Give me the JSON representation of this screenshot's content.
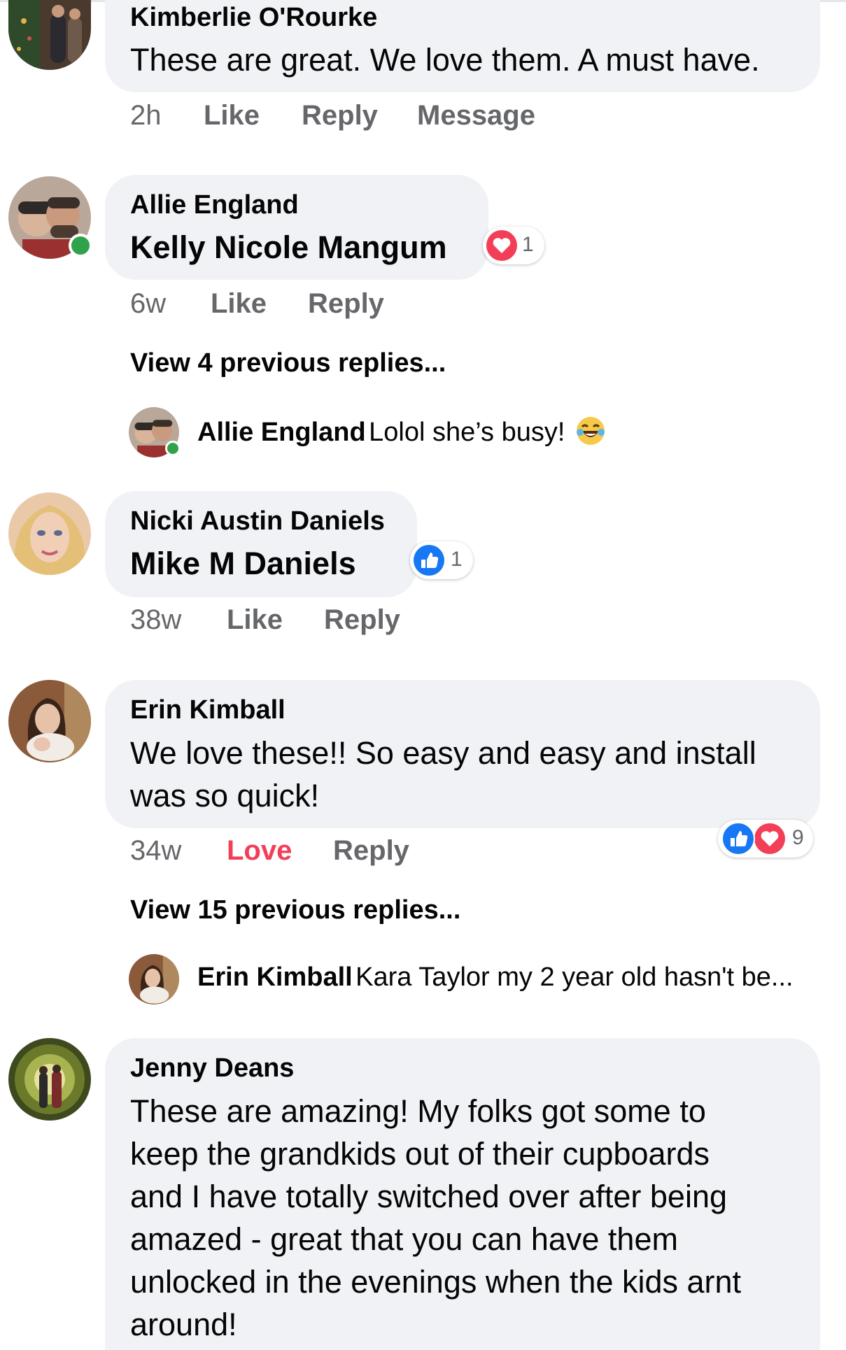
{
  "comments": [
    {
      "author": "Kimberlie O'Rourke",
      "text": "These are great. We love them. A must have.",
      "meta": {
        "time": "2h",
        "like": "Like",
        "reply": "Reply",
        "message": "Message"
      }
    },
    {
      "author": "Allie England",
      "tag": "Kelly Nicole Mangum",
      "reaction": {
        "icons": [
          "heart-icon"
        ],
        "count": "1"
      },
      "meta": {
        "time": "6w",
        "like": "Like",
        "reply": "Reply"
      },
      "view_replies": "View 4 previous replies...",
      "latest_reply": {
        "author": "Allie England",
        "text": "Lolol she’s busy!",
        "emoji": "laughing-tears-emoji"
      }
    },
    {
      "author": "Nicki Austin Daniels",
      "tag": "Mike M Daniels",
      "reaction": {
        "icons": [
          "like-icon"
        ],
        "count": "1"
      },
      "meta": {
        "time": "38w",
        "like": "Like",
        "reply": "Reply"
      }
    },
    {
      "author": "Erin Kimball",
      "text_lines": [
        "We love these!! So easy and easy and install",
        "was so quick!"
      ],
      "reaction": {
        "icons": [
          "like-icon",
          "heart-icon"
        ],
        "count": "9"
      },
      "meta": {
        "time": "34w",
        "like": "Love",
        "reply": "Reply"
      },
      "view_replies": "View 15 previous replies...",
      "latest_reply": {
        "author": "Erin Kimball",
        "text": "Kara Taylor my 2 year old hasn't be..."
      }
    },
    {
      "author": "Jenny Deans",
      "text_lines": [
        "These are amazing! My folks got some to",
        "keep the grandkids out of their cupboards",
        "and I have totally switched over after being",
        "amazed - great that you can have them",
        "unlocked in the evenings when the kids arnt",
        "around!"
      ]
    }
  ],
  "colors": {
    "like_blue": "#1877f2",
    "love_red": "#f33e58",
    "meta_gray": "#65676b",
    "bubble_bg": "#f0f2f5",
    "online_green": "#31a24c"
  }
}
